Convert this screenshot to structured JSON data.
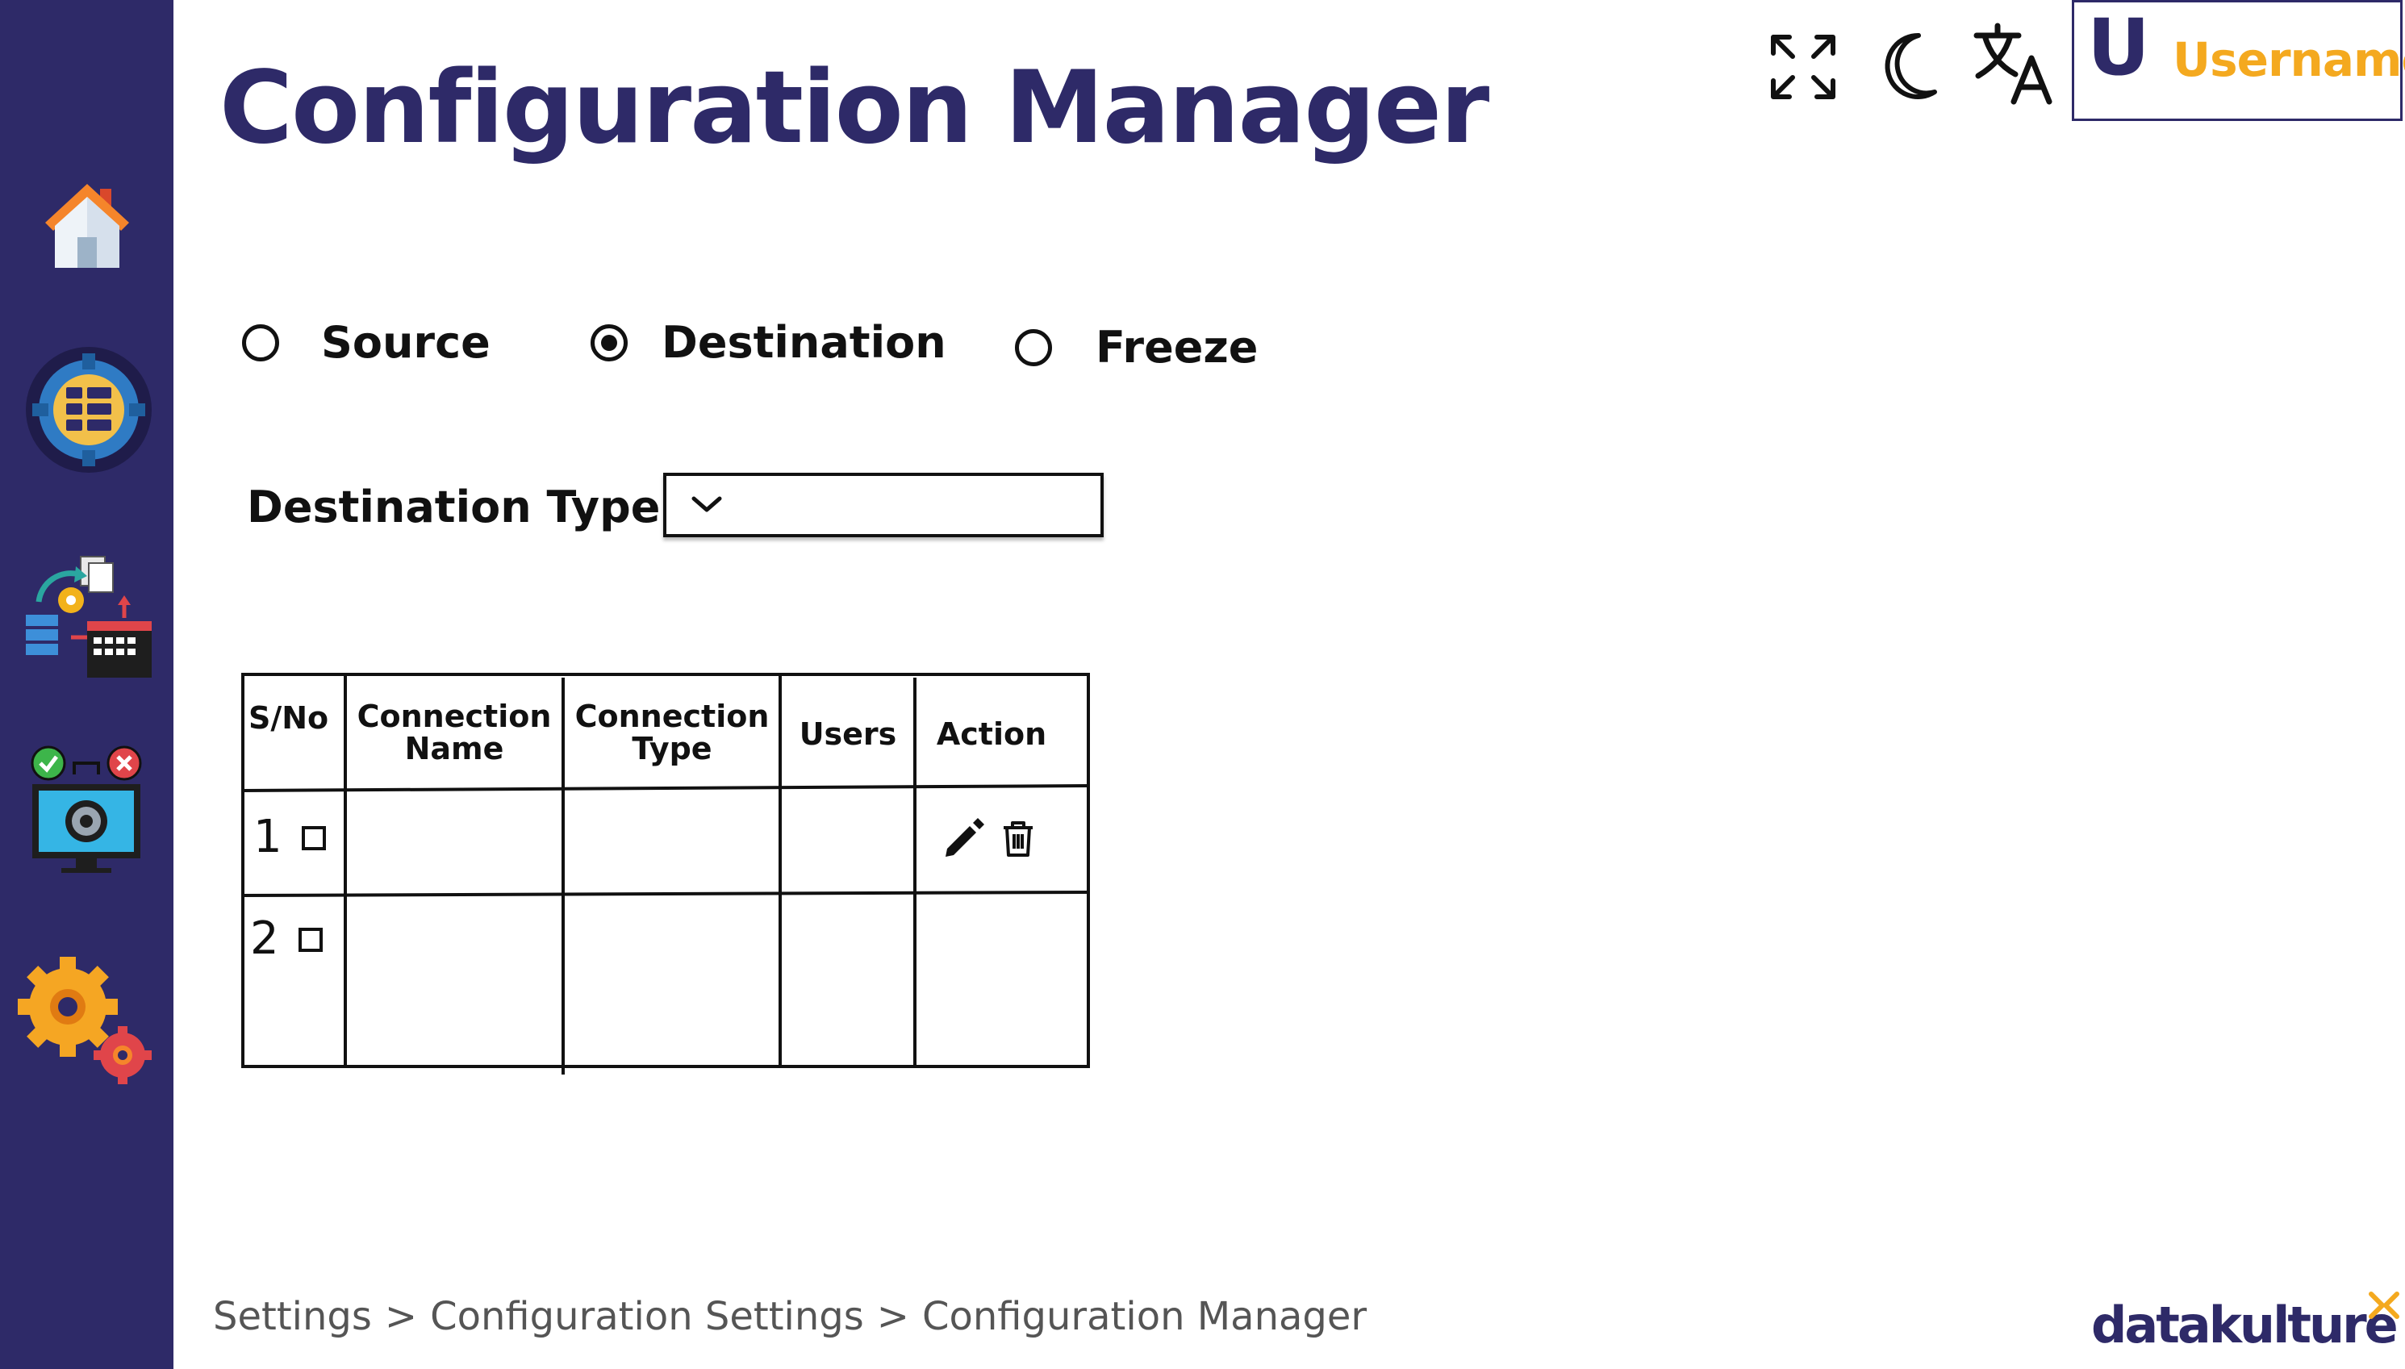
{
  "app": {
    "title": "Configuration Manager"
  },
  "header": {
    "user_initial": "U",
    "username": "Username",
    "icons": [
      "fullscreen-icon",
      "dark-mode-icon",
      "translate-icon"
    ]
  },
  "sidebar": {
    "items": [
      {
        "name": "home",
        "icon": "home-icon"
      },
      {
        "name": "data-settings",
        "icon": "database-gear-icon"
      },
      {
        "name": "scheduler",
        "icon": "schedule-sync-icon"
      },
      {
        "name": "monitor",
        "icon": "monitor-gear-icon"
      },
      {
        "name": "settings",
        "icon": "gears-icon"
      }
    ]
  },
  "mode": {
    "options": [
      {
        "label": "Source",
        "selected": false
      },
      {
        "label": "Destination",
        "selected": true
      },
      {
        "label": "Freeze",
        "selected": false
      }
    ]
  },
  "destination_type": {
    "label": "Destination Type",
    "value": ""
  },
  "table": {
    "columns": {
      "sno": "S/No",
      "connection_name": [
        "Connection",
        "Name"
      ],
      "connection_type": [
        "Connection",
        "Type"
      ],
      "users": "Users",
      "action": "Action"
    },
    "rows": [
      {
        "sno": "1",
        "connection_name": "",
        "connection_type": "",
        "users": "",
        "actions": [
          "edit-icon",
          "delete-icon"
        ]
      },
      {
        "sno": "2",
        "connection_name": "",
        "connection_type": "",
        "users": "",
        "actions": []
      }
    ]
  },
  "breadcrumb": {
    "items": [
      "Settings",
      "Configuration Settings",
      "Configuration Manager"
    ],
    "separator": ">"
  },
  "brand": {
    "name": "datakulture"
  },
  "colors": {
    "sidebar": "#2e2a68",
    "title": "#2e2a68",
    "username": "#f4a91f",
    "brand_accent": "#f4a91f"
  }
}
